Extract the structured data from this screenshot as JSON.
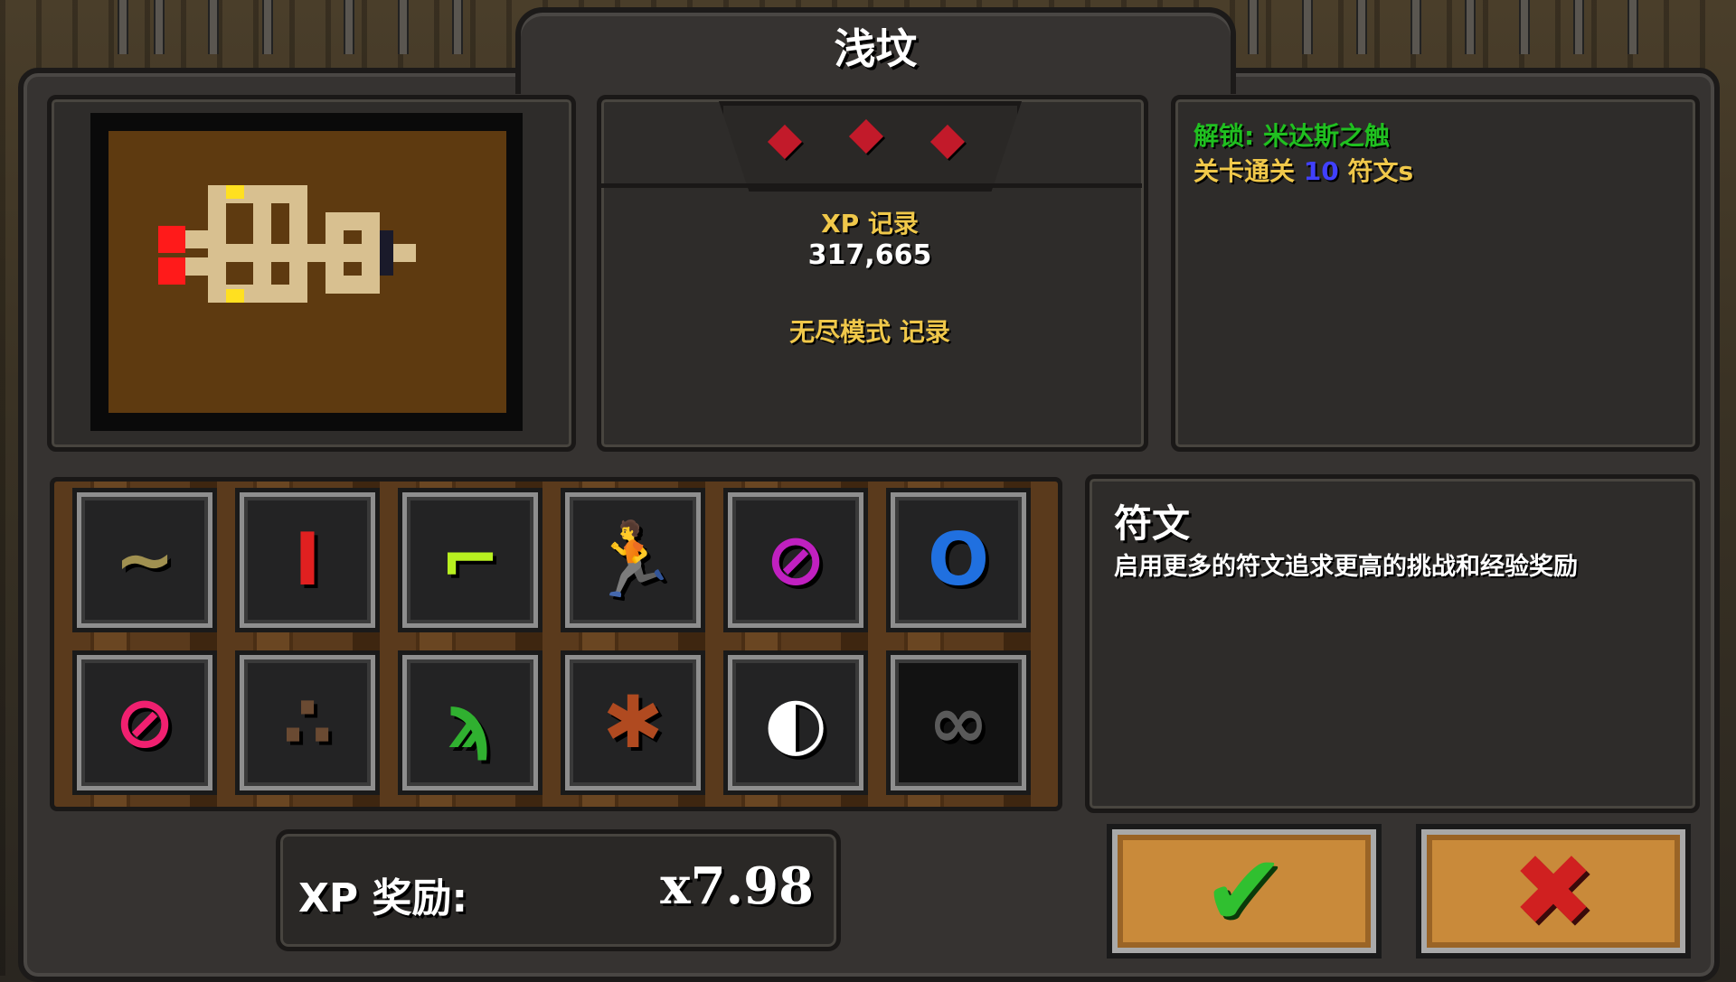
{
  "title": "浅坟",
  "gems": {
    "count": 3,
    "color": "#c21a2a"
  },
  "records": {
    "xp_label": "XP 记录",
    "xp_value": "317,665",
    "endless_label": "无尽模式 记录"
  },
  "unlock": {
    "line1": "解锁: 米达斯之触",
    "line2_prefix": "关卡通关 ",
    "line2_number": "10",
    "line2_suffix": " 符文s"
  },
  "runes": [
    {
      "name": "wave-rune-icon",
      "glyph": "∼",
      "color": "#a09050"
    },
    {
      "name": "red-pillar-rune-icon",
      "glyph": "I",
      "color": "#e02020"
    },
    {
      "name": "green-hook-rune-icon",
      "glyph": "⌐",
      "color": "#b8f020"
    },
    {
      "name": "running-man-rune-icon",
      "glyph": "🏃",
      "color": "#f0b020"
    },
    {
      "name": "purple-null-rune-icon",
      "glyph": "⊘",
      "color": "#c020c0"
    },
    {
      "name": "blue-ring-rune-icon",
      "glyph": "O",
      "color": "#2070e0"
    },
    {
      "name": "pink-slash-rune-icon",
      "glyph": "⊘",
      "color": "#f02070"
    },
    {
      "name": "three-dots-rune-icon",
      "glyph": "∴",
      "color": "#6a4a32"
    },
    {
      "name": "green-sprout-rune-icon",
      "glyph": "ϡ",
      "color": "#30b030"
    },
    {
      "name": "spider-rune-icon",
      "glyph": "✱",
      "color": "#b04a20"
    },
    {
      "name": "white-moon-rune-icon",
      "glyph": "◐",
      "color": "#ffffff"
    },
    {
      "name": "infinity-rune-icon",
      "glyph": "∞",
      "color": "#5a5a5a"
    }
  ],
  "description": {
    "title": "符文",
    "text": "启用更多的符文追求更高的挑战和经验奖励"
  },
  "xp_reward": {
    "label": "XP 奖励:",
    "value": "x7.98"
  },
  "buttons": {
    "confirm_color": "#30c030",
    "cancel_color": "#d02020"
  }
}
